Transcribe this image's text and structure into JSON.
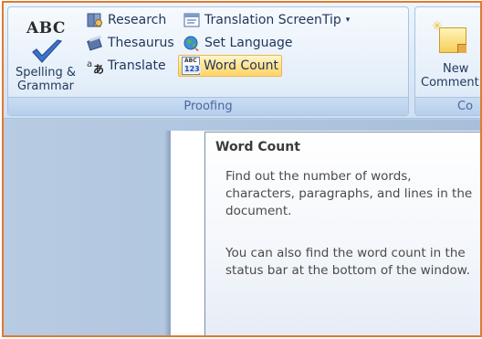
{
  "ribbon": {
    "proofing": {
      "label": "Proofing",
      "spelling": {
        "icon_text": "ABC",
        "label_line1": "Spelling &",
        "label_line2": "Grammar"
      },
      "research": "Research",
      "thesaurus": "Thesaurus",
      "translate": "Translate",
      "translation_screentip": "Translation ScreenTip",
      "set_language": "Set Language",
      "word_count": "Word Count",
      "word_count_icon_top": "ABC",
      "word_count_icon_bottom": "123"
    },
    "comments": {
      "label": "Co",
      "new_comment_line1": "New",
      "new_comment_line2": "Comment"
    }
  },
  "tooltip": {
    "title": "Word Count",
    "paragraph1": "Find out the number of words, characters, paragraphs, and lines in the document.",
    "paragraph2": "You can also find the word count in the status bar at the bottom of the window."
  },
  "colors": {
    "frame_border": "#e07a33",
    "ribbon_text": "#1f355c",
    "group_label_text": "#4a67a0",
    "highlight": "#ffe38e"
  },
  "icons": [
    "check-icon",
    "research-icon",
    "thesaurus-icon",
    "translate-icon",
    "translation-screentip-icon",
    "set-language-icon",
    "word-count-icon",
    "new-comment-icon"
  ]
}
